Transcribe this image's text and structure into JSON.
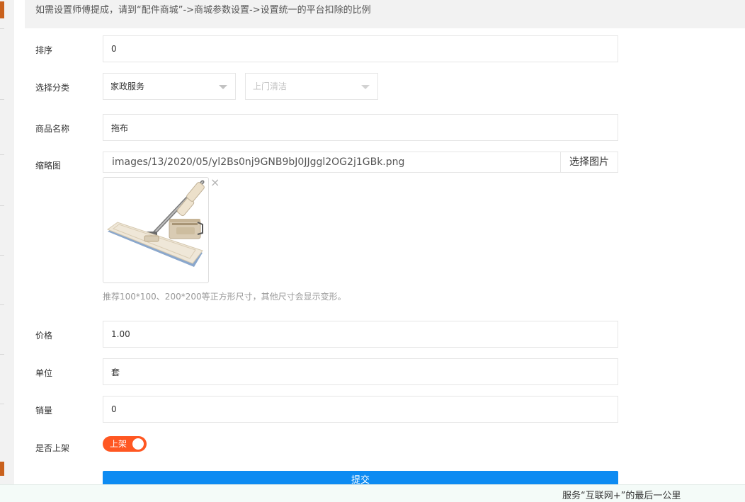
{
  "notice": "如需设置师傅提成，请到“配件商城”->商城参数设置->设置统一的平台扣除的比例",
  "form": {
    "sort": {
      "label": "排序",
      "value": "0"
    },
    "category": {
      "label": "选择分类",
      "primary": "家政服务",
      "secondary": "上门清洁"
    },
    "name": {
      "label": "商品名称",
      "value": "拖布"
    },
    "thumbnail": {
      "label": "缩略图",
      "path": "images/13/2020/05/yl2Bs0nj9GNB9bJ0JJggl2OG2j1GBk.png",
      "pick_label": "选择图片",
      "remove_icon": "×",
      "hint": "推荐100*100、200*200等正方形尺寸，其他尺寸会显示变形。"
    },
    "price": {
      "label": "价格",
      "value": "1.00"
    },
    "unit": {
      "label": "单位",
      "value": "套"
    },
    "sales": {
      "label": "销量",
      "value": "0"
    },
    "on_shelf": {
      "label": "是否上架",
      "switch_text": "上架"
    },
    "submit_label": "提交"
  },
  "footer": {
    "slogan": "服务“互联网+”的最后一公里"
  },
  "colors": {
    "accent": "#ff5722",
    "primary_button": "#0d8bf2",
    "notice_bg": "#f2f2f2",
    "footer_bg": "#f4fbf8"
  }
}
